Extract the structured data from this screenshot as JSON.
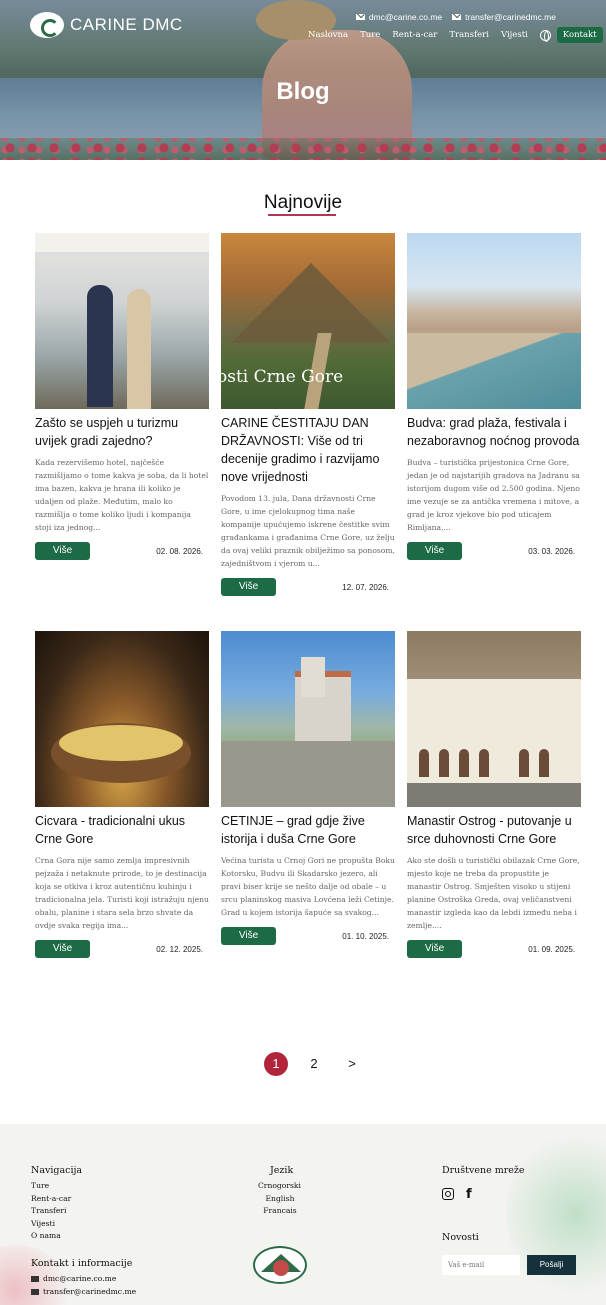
{
  "header": {
    "logo_text": "CARINE DMC",
    "contacts": [
      "dmc@carine.co.me",
      "transfer@carinedmc.me"
    ],
    "nav": [
      "Naslovna",
      "Ture",
      "Rent-a-car",
      "Transferi",
      "Vijesti"
    ],
    "contact_button": "Kontakt",
    "hero_title": "Blog"
  },
  "section": {
    "title": "Najnovije"
  },
  "posts": [
    {
      "title": "Zašto se uspjeh u turizmu uvijek gradi zajedno?",
      "excerpt": "Kada rezervišemo hotel, najčešće razmišljamo o tome kakva je soba, da li hotel ima bazen, kakva je hrana ili koliko je udaljen od plaže. Međutim, malo ko razmišlja o tome koliko ljudi i kompanija stoji iza jednog...",
      "button": "Više",
      "date": "02. 08. 2026."
    },
    {
      "title": "CARINE ČESTITAJU DAN DRŽAVNOSTI: Više od tri decenije gradimo i razvijamo nove vrijednosti",
      "excerpt": "Povodom 13. jula, Dana državnosti Crne Gore, u ime cjelokupnog tima naše kompanije upućujemo iskrene čestitke svim građankama i građanima Crne Gore, uz želju da ovaj veliki praznik obilježimo sa ponosom, zajedništvom i vjerom u...",
      "button": "Više",
      "date": "12. 07. 2026.",
      "image_text": "osti Crne Gore"
    },
    {
      "title": "Budva: grad plaža, festivala i nezaboravnog noćnog provoda",
      "excerpt": "Budva – turistička prijestonica Crne Gore, jedan je od najstarijih gradova na Jadranu sa istorijom dugom više od 2.500 godina. Njeno ime vezuje se za antička vremena i mitove, a grad je kroz vjekove bio pod uticajem Rimljana,...",
      "button": "Više",
      "date": "03. 03. 2026."
    },
    {
      "title": "Cicvara - tradicionalni ukus Crne Gore",
      "excerpt": "Crna Gora nije samo zemlja impresivnih pejzaža i netaknute prirode, to je destinacija koja se otkiva i kroz autentičnu kuhinju i tradicionalna jela. Turisti koji istražuju njenu obalu, planine i stara sela brzo shvate da ovdje svaka regija ima...",
      "button": "Više",
      "date": "02. 12. 2025."
    },
    {
      "title": "CETINJE – grad gdje žive istorija i duša Crne Gore",
      "excerpt": "Većina turista u Crnoj Gori ne propušta Boku Kotorsku, Budvu ili Skadarsko jezero, ali pravi biser krije se nešto dalje od obale – u srcu planinskog masiva Lovćena leži Cetinje. Grad u kojem istorija šapuće sa svakog...",
      "button": "Više",
      "date": "01. 10. 2025."
    },
    {
      "title": "Manastir Ostrog - putovanje u srce duhovnosti Crne Gore",
      "excerpt": "Ako ste došli u turistički obilazak Crne Gore, mjesto koje ne treba da propustite je manastir Ostrog. Smješten visoko u stijeni planine Ostroška Greda, ovaj veličanstveni manastir izgleda kao da lebdi između neba i zemlje....",
      "button": "Više",
      "date": "01. 09. 2025."
    }
  ],
  "pagination": {
    "pages": [
      "1",
      "2"
    ],
    "next": ">",
    "active": "1"
  },
  "footer": {
    "nav_title": "Navigacija",
    "nav_links": [
      "Ture",
      "Rent-a-car",
      "Transferi",
      "Vijesti",
      "O nama"
    ],
    "lang_title": "Jezik",
    "languages": [
      "Crnogorski",
      "English",
      "Francais"
    ],
    "social_title": "Društvene mreže",
    "newsletter_title": "Novosti",
    "email_placeholder": "Vaš e-mail",
    "send_button": "Pošalji",
    "contact_title": "Kontakt i informacije",
    "contacts": [
      "dmc@carine.co.me",
      "transfer@carinedmc.me"
    ]
  },
  "colors": {
    "brand_green": "#1c6b45",
    "accent_red": "#b1243a",
    "footer_bg": "#f3f3f0",
    "dark_button": "#14313c"
  }
}
